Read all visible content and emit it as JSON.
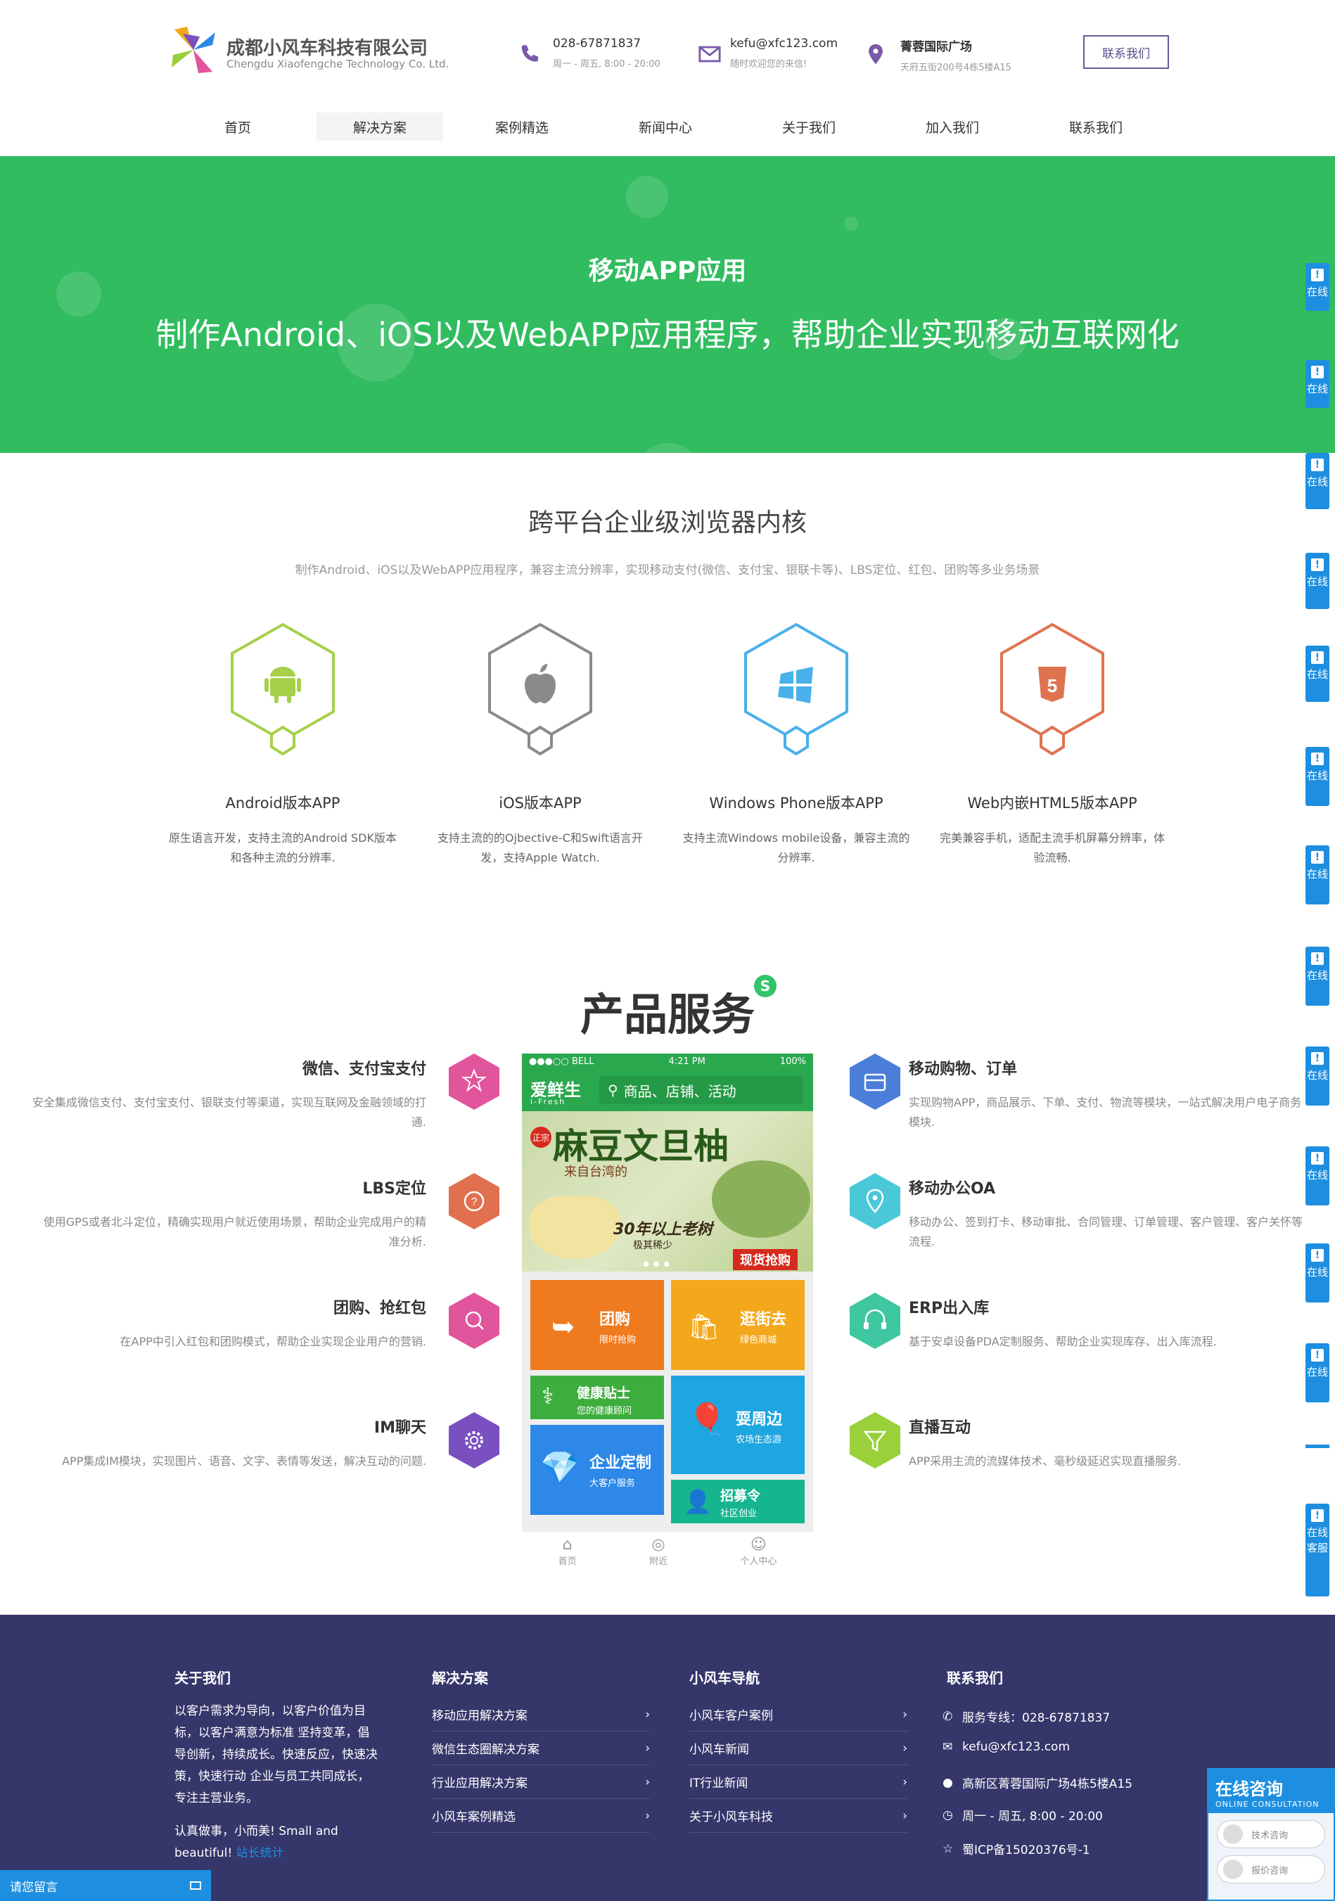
{
  "header": {
    "company_name": "成都小风车科技有限公司",
    "company_en": "Chengdu Xiaofengche Technology Co. Ltd.",
    "phone": "028-67871837",
    "phone_hours": "周一 - 周五, 8:00 - 20:00",
    "email": "kefu@xfc123.com",
    "email_note": "随时欢迎您的来信!",
    "address_title": "菁蓉国际广场",
    "address_detail": "天府五街200号4栋5楼A15",
    "contact_button": "联系我们"
  },
  "nav": [
    "首页",
    "解决方案",
    "案例精选",
    "新闻中心",
    "关于我们",
    "加入我们",
    "联系我们"
  ],
  "banner": {
    "title": "移动APP应用",
    "subtitle": "制作Android、iOS以及WebAPP应用程序，帮助企业实现移动互联网化",
    "bg_color": "#31bc60"
  },
  "platforms_section": {
    "title": "跨平台企业级浏览器内核",
    "subtitle": "制作Android、iOS以及WebAPP应用程序，兼容主流分辨率，实现移动支付(微信、支付宝、银联卡等)、LBS定位、红包、团购等多业务场景",
    "items": [
      {
        "name": "Android版本APP",
        "desc": "原生语言开发，支持主流的Android SDK版本和各种主流的分辨率.",
        "icon": "android-icon",
        "color": "#a6d04a"
      },
      {
        "name": "iOS版本APP",
        "desc": "支持主流的的Ojbective-C和Swift语言开发，支持Apple Watch.",
        "icon": "apple-icon",
        "color": "#8a8a8a"
      },
      {
        "name": "Windows Phone版本APP",
        "desc": "支持主流Windows mobile设备，兼容主流的分辨率.",
        "icon": "windows-icon",
        "color": "#4ab0ea"
      },
      {
        "name": "Web内嵌HTML5版本APP",
        "desc": "完美兼容手机，适配主流手机屏幕分辨率，体验流畅.",
        "icon": "html5-icon",
        "color": "#e0734f"
      }
    ]
  },
  "services": {
    "title": "产品服务",
    "badge": "S",
    "left": [
      {
        "title": "微信、支付宝支付",
        "desc": "安全集成微信支付、支付宝支付、银联支付等渠道，实现互联网及金融领域的打通.",
        "icon": "star-icon",
        "color": "#e0559b"
      },
      {
        "title": "LBS定位",
        "desc": "使用GPS或者北斗定位，精确实现用户就近使用场景，帮助企业完成用户的精准分析.",
        "icon": "question-icon",
        "color": "#e0704f"
      },
      {
        "title": "团购、抢红包",
        "desc": "在APP中引入红包和团购模式，帮助企业实现企业用户的营销.",
        "icon": "search-icon",
        "color": "#e0559b"
      },
      {
        "title": "IM聊天",
        "desc": "APP集成IM模块，实现图片、语音、文字、表情等发送，解决互动的问题.",
        "icon": "gear-icon",
        "color": "#7a4fc0"
      }
    ],
    "right": [
      {
        "title": "移动购物、订单",
        "desc": "实现购物APP，商品展示、下单、支付、物流等模块，一站式解决用户电子商务模块.",
        "icon": "store-icon",
        "color": "#4a7ed8"
      },
      {
        "title": "移动办公OA",
        "desc": "移动办公、签到打卡、移动审批、合同管理、订单管理、客户管理、客户关怀等流程.",
        "icon": "location-icon",
        "color": "#4ac8d8"
      },
      {
        "title": "ERP出入库",
        "desc": "基于安卓设备PDA定制服务、帮助企业实现库存、出入库流程.",
        "icon": "headset-icon",
        "color": "#3ec7a0"
      },
      {
        "title": "直播互动",
        "desc": "APP采用主流的流媒体技术、毫秒级延迟实现直播服务.",
        "icon": "funnel-icon",
        "color": "#9ad03a"
      }
    ]
  },
  "phone": {
    "carrier": "●●●○○ BELL",
    "time": "4:21 PM",
    "battery": "100%",
    "app_name": "爱鲜生",
    "app_en": "i-Fresh",
    "search_placeholder": "商品、店铺、活动",
    "banner_title": "麻豆文旦柚",
    "banner_tag": "正宗",
    "banner_sub": "来自台湾的",
    "banner_note": "30年以上老树",
    "banner_rare": "极其稀少",
    "banner_cta": "现货抢购",
    "tiles": [
      {
        "title": "团购",
        "sub": "限时抢购",
        "color": "#f07a1e"
      },
      {
        "title": "逛街去",
        "sub": "绿色商城",
        "color": "#f3a81c"
      },
      {
        "title": "健康贴士",
        "sub": "您的健康顾问",
        "color": "#3dae3d"
      },
      {
        "title": "耍周边",
        "sub": "农场生态游",
        "color": "#1ea6e0"
      },
      {
        "title": "企业定制",
        "sub": "大客户服务",
        "color": "#2d88e8"
      },
      {
        "title": "招募令",
        "sub": "社区创业",
        "color": "#15b58f"
      }
    ],
    "tabbar": [
      "首页",
      "附近",
      "个人中心"
    ]
  },
  "footer": {
    "about_title": "关于我们",
    "about_text": "以客户需求为导向，以客户价值为目标，以客户满意为标准 坚持变革，倡导创新，持续成长。快速反应，快速决策，快速行动 企业与员工共同成长， 专注主营业务。",
    "about_motto": "认真做事，小而美!  Small and beautiful!",
    "stats_link": "站长统计",
    "solutions_title": "解决方案",
    "solutions": [
      "移动应用解决方案",
      "微信生态圈解决方案",
      "行业应用解决方案",
      "小风车案例精选"
    ],
    "nav_title": "小风车导航",
    "nav_links": [
      "小风车客户案例",
      "小风车新闻",
      "IT行业新闻",
      "关于小风车科技"
    ],
    "contact_title": "联系我们",
    "contact": [
      {
        "icon": "phone-icon",
        "text": "服务专线：028-67871837"
      },
      {
        "icon": "mail-icon",
        "text": "kefu@xfc123.com"
      },
      {
        "icon": "pin-icon",
        "text": "高新区菁蓉国际广场4栋5楼A15"
      },
      {
        "icon": "clock-icon",
        "text": "周一 - 周五, 8:00 - 20:00"
      },
      {
        "icon": "star-icon",
        "text": "蜀ICP备15020376号-1"
      }
    ]
  },
  "side_float": {
    "tab_label": "在线",
    "last_tab_label": "在线客服",
    "chat_title": "在线咨询",
    "chat_en": "ONLINE CONSULTATION",
    "chat_buttons": [
      "技术咨询",
      "报价咨询"
    ],
    "leave_message": "请您留言"
  }
}
